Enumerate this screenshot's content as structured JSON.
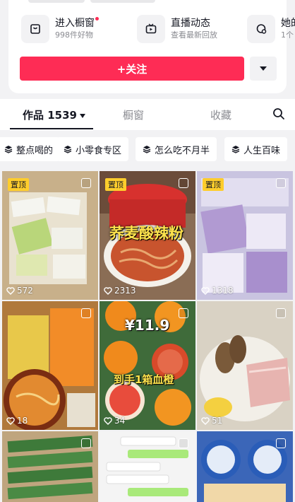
{
  "shop_entries": [
    {
      "title": "进入橱窗",
      "subtitle": "998件好物",
      "has_dot": true,
      "icon": "bag-icon"
    },
    {
      "title": "直播动态",
      "subtitle": "查看最新回放",
      "has_dot": false,
      "icon": "tv-icon"
    },
    {
      "title": "她的",
      "subtitle": "1个",
      "has_dot": false,
      "icon": "chat-icon"
    }
  ],
  "follow_button": "+关注",
  "tabs": {
    "works": "作品 1539",
    "showcase": "橱窗",
    "favorites": "收藏"
  },
  "chips": [
    "整点喝的",
    "小零食专区",
    "怎么吃不月半",
    "人生百味"
  ],
  "pinned_label": "置顶",
  "videos": [
    {
      "likes": "572",
      "pinned": true,
      "caption": ""
    },
    {
      "likes": "2313",
      "pinned": true,
      "caption": "荞麦酸辣粉"
    },
    {
      "likes": "1318",
      "pinned": true,
      "caption": ""
    },
    {
      "likes": "18",
      "pinned": false,
      "caption": ""
    },
    {
      "likes": "34",
      "pinned": false,
      "caption": "¥11.9"
    },
    {
      "likes": "51",
      "pinned": false,
      "caption": ""
    },
    {
      "likes": "",
      "pinned": false,
      "caption": ""
    },
    {
      "likes": "",
      "pinned": false,
      "caption": ""
    },
    {
      "likes": "",
      "pinned": false,
      "caption": ""
    }
  ],
  "video4_subcaption": "到手1箱血橙",
  "colors": {
    "brand_red": "#fe2c55",
    "pin_yellow": "#fecd2c"
  }
}
